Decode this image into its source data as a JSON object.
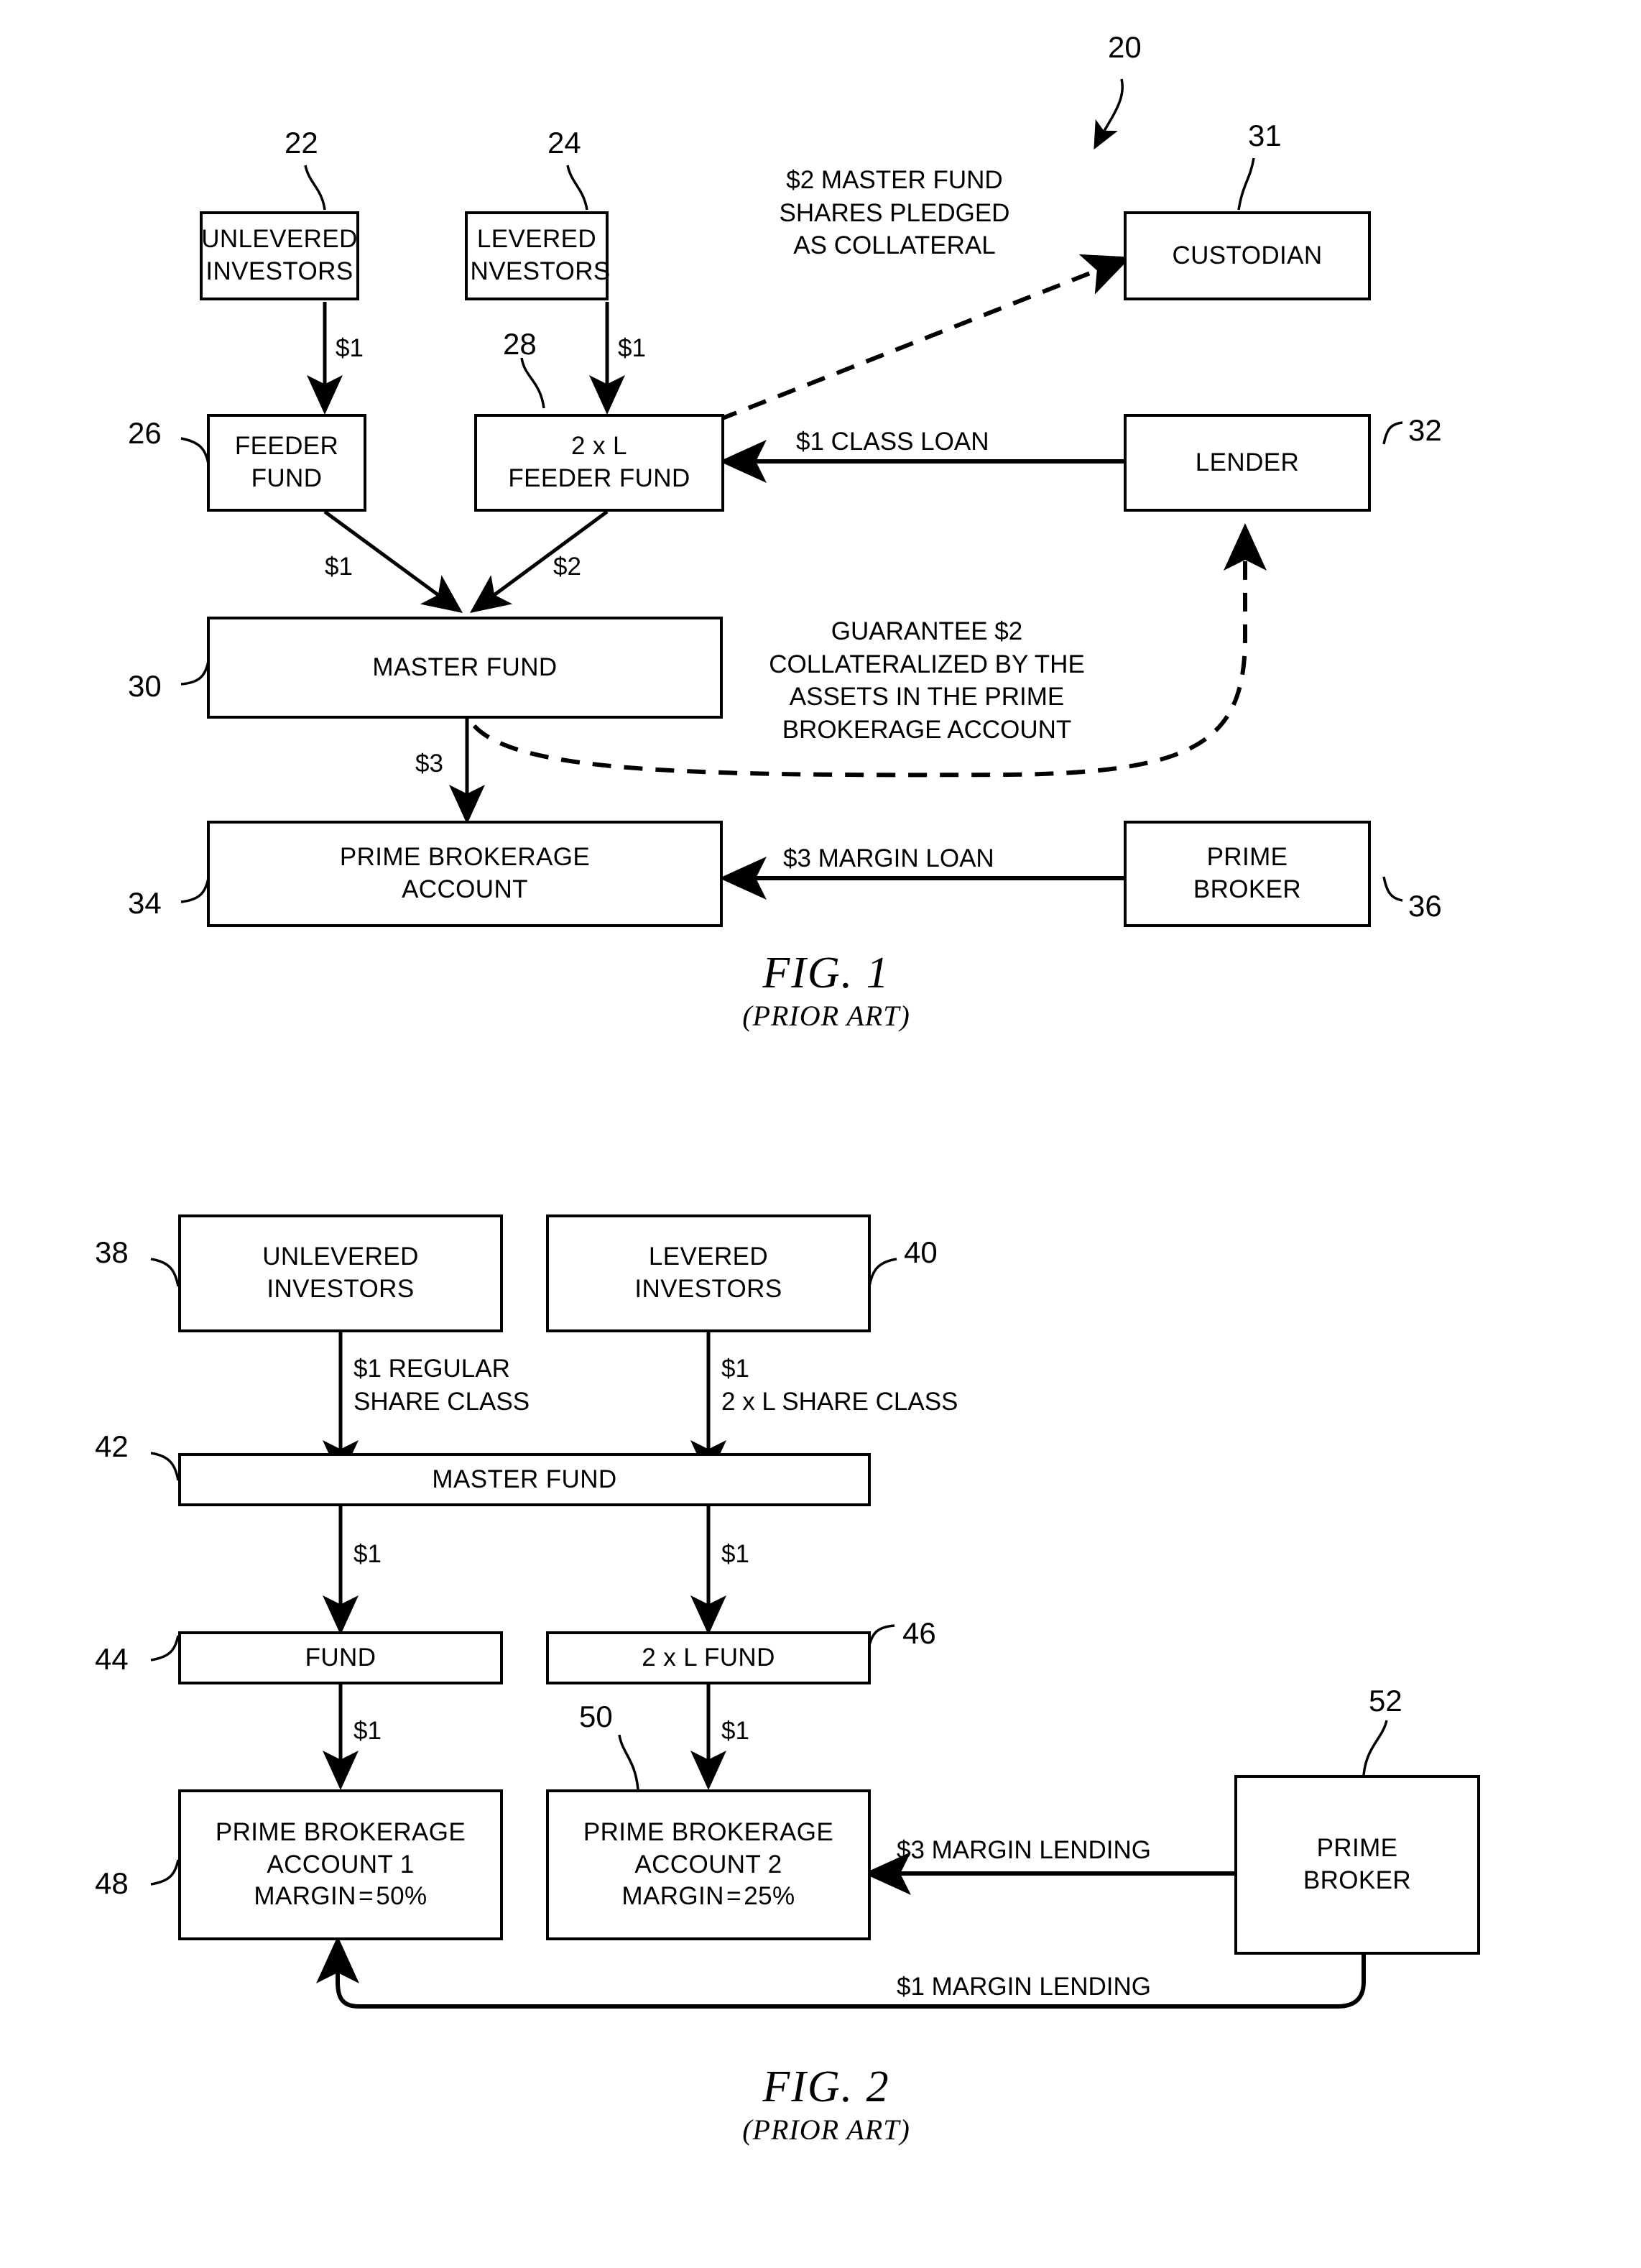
{
  "figures": [
    {
      "id": "fig1",
      "caption_number": "FIG. 1",
      "caption_sub": "(PRIOR ART)",
      "overall_ref": "20",
      "boxes": {
        "unlevered_investors": {
          "line1": "UNLEVERED",
          "line2": "INVESTORS",
          "ref": "22"
        },
        "levered_investors": {
          "line1": "LEVERED",
          "line2": "INVESTORS",
          "ref": "24"
        },
        "custodian": {
          "line1": "CUSTODIAN",
          "ref": "31"
        },
        "feeder_fund": {
          "line1": "FEEDER",
          "line2": "FUND",
          "ref": "26"
        },
        "levered_feeder_fund": {
          "line1": "2 x L",
          "line2": "FEEDER FUND",
          "ref": "28"
        },
        "lender": {
          "line1": "LENDER",
          "ref": "32"
        },
        "master_fund": {
          "line1": "MASTER FUND",
          "ref": "30"
        },
        "prime_brokerage_account": {
          "line1": "PRIME BROKERAGE",
          "line2": "ACCOUNT",
          "ref": "34"
        },
        "prime_broker": {
          "line1": "PRIME",
          "line2": "BROKER",
          "ref": "36"
        }
      },
      "edges": {
        "unlevered_to_feeder": "$1",
        "levered_to_levered_feeder": "$1",
        "feeder_to_master": "$1",
        "levered_feeder_to_master": "$2",
        "master_to_pba": "$3",
        "lender_to_levered_feeder": "$1 CLASS LOAN",
        "prime_broker_to_pba": "$3 MARGIN LOAN",
        "pledge_note_l1": "$2 MASTER FUND",
        "pledge_note_l2": "SHARES PLEDGED",
        "pledge_note_l3": "AS COLLATERAL",
        "guarantee_note_l1": "GUARANTEE $2",
        "guarantee_note_l2": "COLLATERALIZED BY THE",
        "guarantee_note_l3": "ASSETS IN THE PRIME",
        "guarantee_note_l4": "BROKERAGE ACCOUNT"
      }
    },
    {
      "id": "fig2",
      "caption_number": "FIG. 2",
      "caption_sub": "(PRIOR ART)",
      "boxes": {
        "unlevered_investors": {
          "line1": "UNLEVERED",
          "line2": "INVESTORS",
          "ref": "38"
        },
        "levered_investors": {
          "line1": "LEVERED",
          "line2": "INVESTORS",
          "ref": "40"
        },
        "master_fund": {
          "line1": "MASTER FUND",
          "ref": "42"
        },
        "fund": {
          "line1": "FUND",
          "ref": "44"
        },
        "levered_fund": {
          "line1": "2 x L FUND",
          "ref": "46"
        },
        "pba1": {
          "line1": "PRIME BROKERAGE",
          "line2": "ACCOUNT 1",
          "line3": "MARGIN = 50%",
          "ref": "48"
        },
        "pba2": {
          "line1": "PRIME BROKERAGE",
          "line2": "ACCOUNT 2",
          "line3": "MARGIN = 25%",
          "ref": "50"
        },
        "prime_broker": {
          "line1": "PRIME",
          "line2": "BROKER",
          "ref": "52"
        }
      },
      "edges": {
        "unlevered_to_master_l1": "$1 REGULAR",
        "unlevered_to_master_l2": "SHARE CLASS",
        "levered_to_master_l1": "$1",
        "levered_to_master_l2": "2 x L SHARE CLASS",
        "master_to_fund": "$1",
        "master_to_levered_fund": "$1",
        "fund_to_pba1": "$1",
        "levered_fund_to_pba2": "$1",
        "broker_to_pba2": "$3 MARGIN LENDING",
        "broker_to_pba1": "$1 MARGIN LENDING"
      }
    }
  ]
}
